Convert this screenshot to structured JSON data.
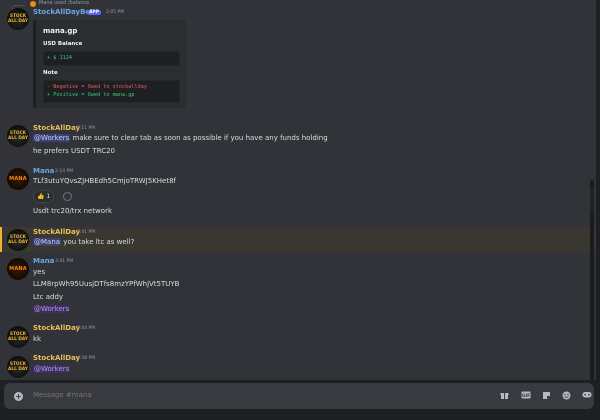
{
  "reply_header": {
    "user": "Mana",
    "used": "used",
    "command": "/balance"
  },
  "messages": [
    {
      "author": "StockAllDayBot",
      "badge": "APP",
      "time": "2:05 PM",
      "embed": {
        "title": "mana.gp",
        "balance_label": "USD Balance",
        "balance_value": "+ $ 1124",
        "note_label": "Note",
        "note_lines": [
          "- Negative = Owed to stockallday",
          "+ Positive = Owed to mana.gp"
        ]
      }
    },
    {
      "author": "StockAllDay",
      "time": "2:11 PM",
      "mention": "@Workers",
      "line1": "make sure to clear tab as soon as possible if you have any funds holding",
      "line2": "he prefers USDT TRC20"
    },
    {
      "author": "Mana",
      "time": "2:14 PM",
      "line1": "TLf3utuYQvsZJHBEdh5CmjoTRWJ5KHet8f",
      "reaction_emoji": "👍",
      "reaction_count": "1",
      "line2": "Usdt trc20/trx network"
    },
    {
      "author": "StockAllDay",
      "time": "3:41 PM",
      "mention": "@Mana",
      "text": "you take ltc as well?"
    },
    {
      "author": "Mana",
      "time": "3:41 PM",
      "line1": "yes",
      "line2": "LLM8rpWh95UusjDTfs8mzYPfWhjVt5TUYB",
      "line3": "Ltc addy",
      "mention": "@Workers"
    },
    {
      "author": "StockAllDay",
      "time": "3:44 PM",
      "text": "kk"
    },
    {
      "author": "StockAllDay",
      "time": "4:38 PM",
      "mention": "@Workers"
    }
  ],
  "avatar_labels": {
    "stock": [
      "STOCK",
      "ALL DAY"
    ],
    "mana": "MANA"
  },
  "input": {
    "placeholder": "Message #mana"
  },
  "toolbar_icons": [
    "gift-icon",
    "gif-icon",
    "sticker-icon",
    "emoji-icon",
    "apps-icon"
  ],
  "colors": {
    "accent": "#5865f2",
    "gold_name": "#e7c05a",
    "blue_name": "#69a9e6",
    "highlight": "#f0b232",
    "background": "#313338"
  }
}
